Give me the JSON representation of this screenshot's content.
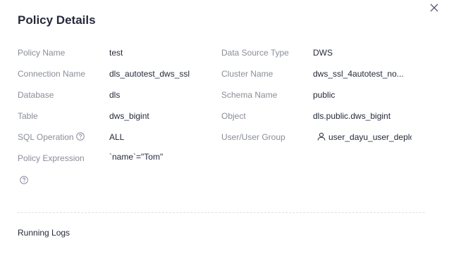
{
  "dialog": {
    "title": "Policy Details"
  },
  "fields": {
    "policy_name": {
      "label": "Policy Name",
      "value": "test"
    },
    "data_source_type": {
      "label": "Data Source Type",
      "value": "DWS"
    },
    "connection_name": {
      "label": "Connection Name",
      "value": "dls_autotest_dws_ssl"
    },
    "cluster_name": {
      "label": "Cluster Name",
      "value": "dws_ssl_4autotest_no..."
    },
    "database": {
      "label": "Database",
      "value": "dls"
    },
    "schema_name": {
      "label": "Schema Name",
      "value": "public"
    },
    "table": {
      "label": "Table",
      "value": "dws_bigint"
    },
    "object": {
      "label": "Object",
      "value": "dls.public.dws_bigint"
    },
    "sql_operation": {
      "label": "SQL Operation",
      "value": "ALL"
    },
    "user_group": {
      "label": "User/User Group",
      "value": "user_dayu_user_deplc"
    },
    "policy_expression": {
      "label": "Policy Expression",
      "value": "`name`=\"Tom\""
    }
  },
  "running_logs": {
    "title": "Running Logs"
  },
  "icons": {
    "close": "close-icon",
    "help": "help-icon",
    "user": "user-icon"
  }
}
